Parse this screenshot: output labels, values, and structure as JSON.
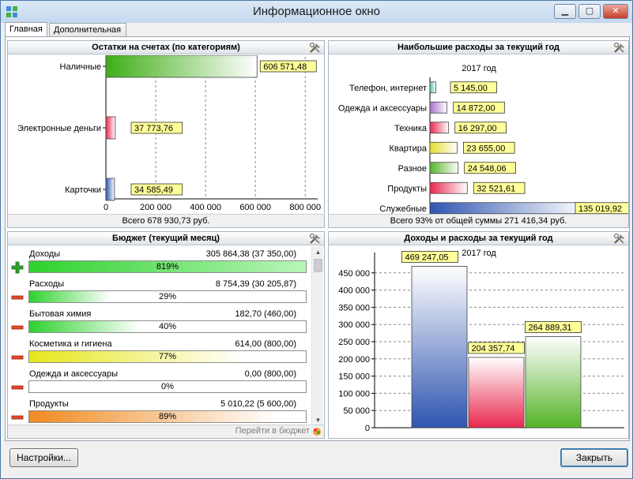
{
  "window": {
    "title": "Информационное окно",
    "buttons": {
      "minimize": "▁",
      "maximize": "▢",
      "close": "✕"
    }
  },
  "tabs": [
    {
      "label": "Главная",
      "active": true
    },
    {
      "label": "Дополнительная",
      "active": false
    }
  ],
  "accounts_panel": {
    "title": "Остатки на счетах (по категориям)",
    "footer": "Всего 678 930,73 руб.",
    "chart_data": {
      "type": "bar",
      "orientation": "horizontal",
      "categories": [
        "Наличные",
        "Электронные деньги",
        "Карточки"
      ],
      "values": [
        606571.48,
        37773.76,
        34585.49
      ],
      "value_labels": [
        "606 571,48",
        "37 773,76",
        "34 585,49"
      ],
      "xlim": [
        0,
        850000
      ],
      "xticks": [
        0,
        200000,
        400000,
        600000,
        800000
      ],
      "xtick_labels": [
        "0",
        "200 000",
        "400 000",
        "600 000",
        "800 000"
      ],
      "colors": [
        "#3fae17",
        "#e8284e",
        "#2f55b0"
      ],
      "grid": true
    }
  },
  "expenses_panel": {
    "title": "Наибольшие расходы за текущий год",
    "subtitle": "2017 год",
    "footer": "Всего 93% от общей суммы 271 416,34 руб.",
    "chart_data": {
      "type": "bar",
      "orientation": "horizontal",
      "categories": [
        "Телефон, интернет",
        "Одежда и аксессуары",
        "Техника",
        "Квартира",
        "Разное",
        "Продукты",
        "Служебные"
      ],
      "values": [
        5145.0,
        14872.0,
        16297.0,
        23655.0,
        24548.06,
        32521.61,
        135019.92
      ],
      "value_labels": [
        "5 145,00",
        "14 872,00",
        "16 297,00",
        "23 655,00",
        "24 548,06",
        "32 521,61",
        "135 019,92"
      ],
      "xlim": [
        0,
        165000
      ],
      "colors": [
        "#4fc0b8",
        "#a670cc",
        "#e8284e",
        "#e4de2a",
        "#55b327",
        "#e8284e",
        "#2f55b0"
      ]
    }
  },
  "budget_panel": {
    "title": "Бюджет (текущий месяц)",
    "link": "Перейти в бюджет",
    "items": [
      {
        "name": "Доходы",
        "amount": "305 864,38 (37 350,00)",
        "percent_label": "819%",
        "fill": 1.0,
        "sign": "plus",
        "color": "#2ed12e"
      },
      {
        "name": "Расходы",
        "amount": "8 754,39 (30 205,87)",
        "percent_label": "29%",
        "fill": 0.29,
        "sign": "minus",
        "color": "#2ed12e"
      },
      {
        "name": "Бытовая химия",
        "amount": "182,70 (460,00)",
        "percent_label": "40%",
        "fill": 0.4,
        "sign": "minus",
        "color": "#2ed12e"
      },
      {
        "name": "Косметика и гигиена",
        "amount": "614,00 (800,00)",
        "percent_label": "77%",
        "fill": 0.77,
        "sign": "minus",
        "color": "#e6e61a"
      },
      {
        "name": "Одежда и аксессуары",
        "amount": "0,00 (800,00)",
        "percent_label": "0%",
        "fill": 0.0,
        "sign": "minus",
        "color": "#2ed12e"
      },
      {
        "name": "Продукты",
        "amount": "5 010,22 (5 600,00)",
        "percent_label": "89%",
        "fill": 0.89,
        "sign": "minus",
        "color": "#f08a20"
      }
    ],
    "scroll": {
      "up": "▲",
      "down": "▼"
    }
  },
  "income_panel": {
    "title": "Доходы и расходы за текущий год",
    "subtitle": "2017 год",
    "chart_data": {
      "type": "bar",
      "orientation": "vertical",
      "values": [
        469247.05,
        204357.74,
        264889.31
      ],
      "value_labels": [
        "469 247,05",
        "204 357,74",
        "264 889,31"
      ],
      "ylim": [
        0,
        500000
      ],
      "yticks": [
        0,
        50000,
        100000,
        150000,
        200000,
        250000,
        300000,
        350000,
        400000,
        450000
      ],
      "ytick_labels": [
        "0",
        "50 000",
        "100 000",
        "150 000",
        "200 000",
        "250 000",
        "300 000",
        "350 000",
        "400 000",
        "450 000"
      ],
      "colors": [
        "#2f55b0",
        "#e8284e",
        "#55b327"
      ],
      "grid": true
    }
  },
  "footer": {
    "settings_button": "Настройки...",
    "close_button": "Закрыть"
  }
}
